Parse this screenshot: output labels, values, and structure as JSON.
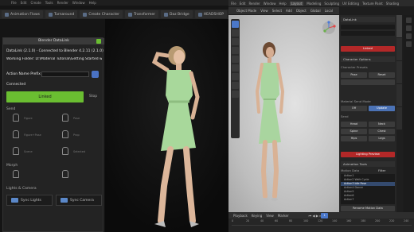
{
  "daz": {
    "menu": [
      "File",
      "Edit",
      "Create",
      "Tools",
      "Render",
      "Window",
      "Help"
    ],
    "tabs": [
      "Animation Flows",
      "Turnaround",
      "Create Character",
      "Transformer",
      "Daz Bridge",
      "HEADSHOP"
    ],
    "panel_title": "Blender DataLink",
    "version_line": "DataLink (2.1.0) · Connected to Blender 4.2.11 (2.1.0)",
    "folder_line": "Working Folder: D:\\Material Tutorial\\Getting Started with Blender Tut",
    "prefix_label": "Action Name Prefix",
    "prefix_value": "",
    "status": "Connected",
    "link_label": "Linked",
    "stop_label": "Stop",
    "send_label": "Send",
    "send_items": [
      "Figure",
      "Pose",
      "Figure+Pose",
      "Prop",
      "Scene",
      "Selected"
    ],
    "morph_label": "Morph",
    "lights_label": "Lights & Camera",
    "sync_lights": "Sync Lights",
    "sync_camera": "Sync Camera"
  },
  "blender": {
    "top_menu": [
      "File",
      "Edit",
      "Render",
      "Window",
      "Help"
    ],
    "workspaces": [
      "Layout",
      "Modeling",
      "Sculpting",
      "UV Editing",
      "Texture Paint",
      "Shading"
    ],
    "header": [
      "Object Mode",
      "View",
      "Select",
      "Add",
      "Object",
      "Global",
      "Local"
    ],
    "panel_title": "DataLink",
    "n_panel": {
      "field1": "",
      "field2": "",
      "link_btn": "Linked",
      "options": "Character Options",
      "character_presets": "Character Presets",
      "pose_btn": "Pose",
      "pose_reset": "Reset",
      "material_section": "Material Send Mode",
      "mat_a": "Off",
      "mat_b": "Update",
      "send_label": "Send",
      "row1": [
        "Head",
        "Neck",
        "Spine",
        "Chest",
        "Hips",
        "Legs"
      ],
      "lighting_label": "Lighting Preview",
      "animation_tools": "Animation Tools",
      "motion_data": "Motion Data",
      "filter_label": "Filter",
      "actions": [
        "Action1",
        "Action2 Walk Cycle",
        "Action3 Idle Pose",
        "Action4 Dance",
        "Action5",
        "Action6",
        "Action7"
      ],
      "rename": "Rename Motion Data"
    },
    "timeline": {
      "menu": [
        "Playback",
        "Keying",
        "View",
        "Marker"
      ],
      "current_frame": "1",
      "ticks": [
        "0",
        "20",
        "40",
        "60",
        "80",
        "100",
        "120",
        "140",
        "160",
        "180",
        "200",
        "220",
        "240"
      ]
    }
  }
}
